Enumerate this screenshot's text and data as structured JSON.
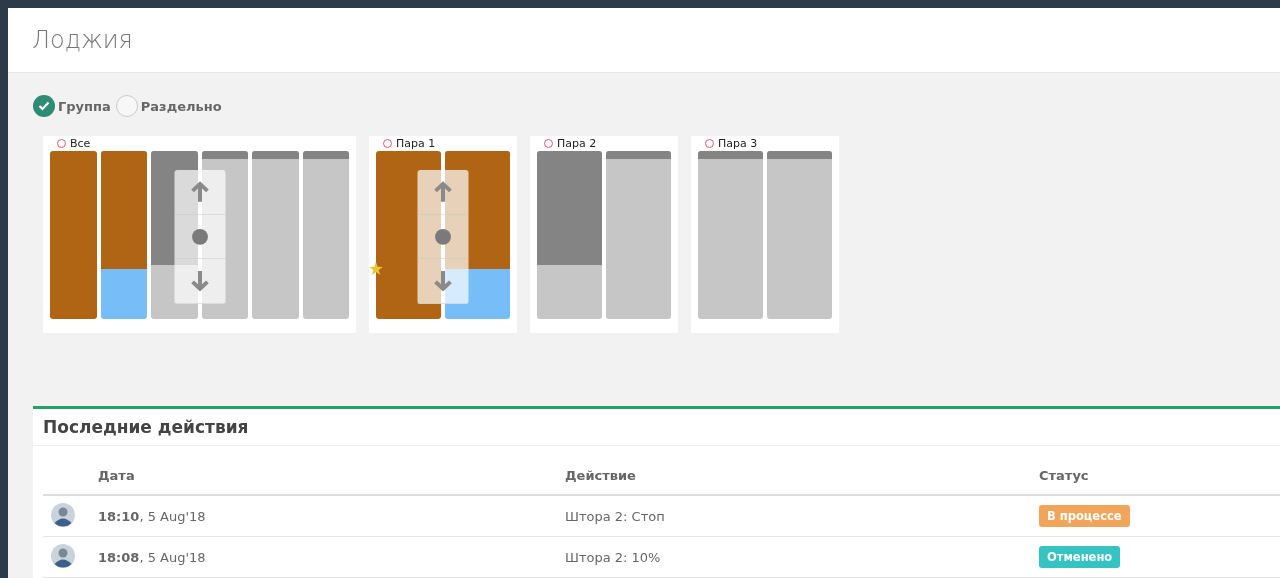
{
  "page": {
    "title": "Лоджия"
  },
  "mode_options": [
    {
      "label": "Группа",
      "selected": true
    },
    {
      "label": "Раздельно",
      "selected": false
    }
  ],
  "groups": [
    {
      "label": "Все",
      "controls": true,
      "favorite": false,
      "curtains": [
        {
          "selected": true,
          "level": 1
        },
        {
          "selected": true,
          "level": 0.7
        },
        {
          "selected": false,
          "level": 0.68
        },
        {
          "selected": false,
          "level": 0.05
        },
        {
          "selected": false,
          "level": 0.05
        },
        {
          "selected": false,
          "level": 0.05
        }
      ]
    },
    {
      "label": "Пара 1",
      "controls": true,
      "favorite": true,
      "curtains": [
        {
          "selected": true,
          "level": 1
        },
        {
          "selected": true,
          "level": 0.7
        }
      ]
    },
    {
      "label": "Пара 2",
      "controls": false,
      "favorite": false,
      "curtains": [
        {
          "selected": false,
          "level": 0.68
        },
        {
          "selected": false,
          "level": 0.05
        }
      ]
    },
    {
      "label": "Пара 3",
      "controls": false,
      "favorite": false,
      "curtains": [
        {
          "selected": false,
          "level": 0.05
        },
        {
          "selected": false,
          "level": 0.05
        }
      ]
    }
  ],
  "recent": {
    "title": "Последние действия",
    "columns": [
      "Дата",
      "Действие",
      "Статус"
    ],
    "rows": [
      {
        "date": "**18:10**, 5 Aug'18",
        "action": "Штора 2: Стоп",
        "status": "В процессе",
        "color": "#f0a55a"
      },
      {
        "date": "**18:08**, 5 Aug'18",
        "action": "Штора 2: 10%",
        "status": "Отменено",
        "color": "#35c3c3"
      }
    ]
  }
}
